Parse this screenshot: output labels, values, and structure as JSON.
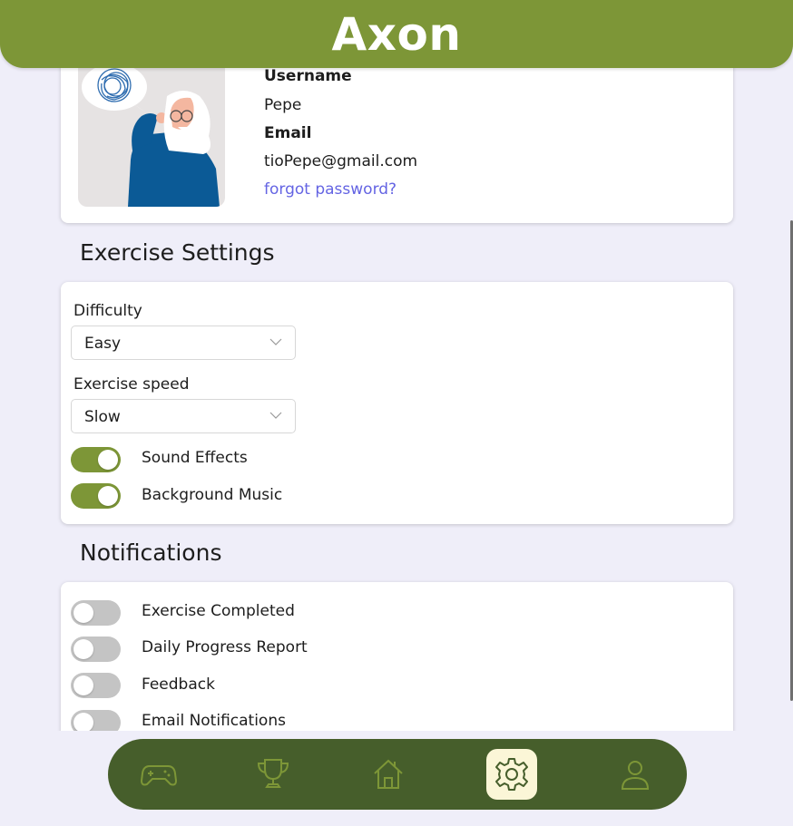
{
  "app": {
    "title": "Axon"
  },
  "profile": {
    "username_label": "Username",
    "username": "Pepe",
    "email_label": "Email",
    "email": "tioPepe@gmail.com",
    "forgot_password": "forgot password?"
  },
  "exercise_settings": {
    "title": "Exercise Settings",
    "difficulty_label": "Difficulty",
    "difficulty_value": "Easy",
    "speed_label": "Exercise speed",
    "speed_value": "Slow",
    "toggles": [
      {
        "label": "Sound Effects",
        "on": true
      },
      {
        "label": "Background Music",
        "on": true
      }
    ]
  },
  "notifications": {
    "title": "Notifications",
    "toggles": [
      {
        "label": "Exercise Completed",
        "on": false
      },
      {
        "label": "Daily Progress Report",
        "on": false
      },
      {
        "label": "Feedback",
        "on": false
      },
      {
        "label": "Email Notifications",
        "on": false
      }
    ]
  },
  "nav": {
    "items": [
      {
        "icon": "gamepad-icon"
      },
      {
        "icon": "trophy-icon"
      },
      {
        "icon": "home-icon"
      },
      {
        "icon": "gear-icon",
        "active": true
      },
      {
        "icon": "user-icon"
      }
    ]
  },
  "colors": {
    "accent": "#7d9637",
    "nav_background": "#465e2b",
    "active_nav": "#fbf6d7",
    "link": "#6464e3",
    "toggle_off": "#c4c4c4",
    "page_background": "#efeef9"
  }
}
